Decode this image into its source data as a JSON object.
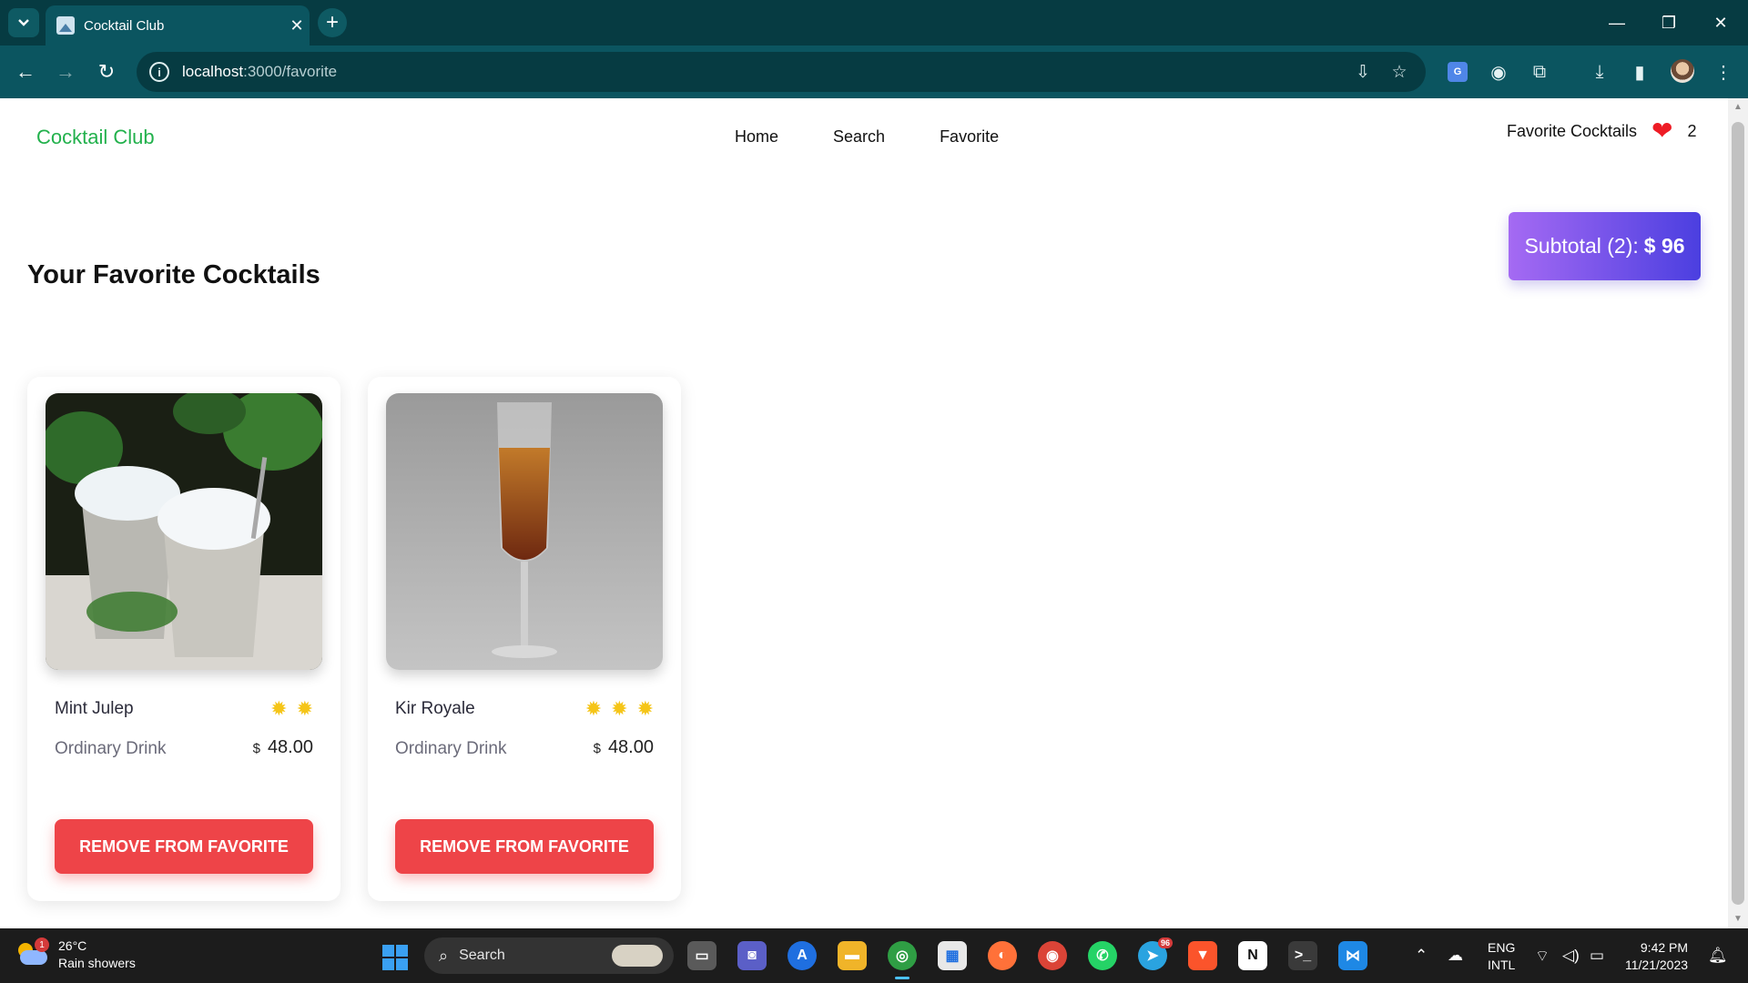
{
  "browser": {
    "tab_title": "Cocktail Club",
    "url_host": "localhost",
    "url_path": ":3000/favorite"
  },
  "page": {
    "brand": "Cocktail Club",
    "nav": [
      "Home",
      "Search",
      "Favorite"
    ],
    "favorites_label": "Favorite Cocktails",
    "favorites_count": "2",
    "subtotal_label": "Subtotal (2):",
    "subtotal_value": "$ 96",
    "heading": "Your Favorite Cocktails",
    "cards": [
      {
        "name": "Mint Julep",
        "rating": 2,
        "category": "Ordinary Drink",
        "currency": "$",
        "price": "48.00",
        "button": "REMOVE FROM FAVORITE"
      },
      {
        "name": "Kir Royale",
        "rating": 3,
        "category": "Ordinary Drink",
        "currency": "$",
        "price": "48.00",
        "button": "REMOVE FROM FAVORITE"
      }
    ]
  },
  "taskbar": {
    "weather_temp": "26°C",
    "weather_desc": "Rain showers",
    "weather_badge": "1",
    "search_label": "Search",
    "telegram_badge": "96",
    "lang_top": "ENG",
    "lang_bottom": "INTL",
    "time": "9:42 PM",
    "date": "11/21/2023"
  },
  "colors": {
    "brand_green": "#22b14c",
    "remove_red": "#ee4448",
    "subtotal_gradient_start": "#a56af3",
    "subtotal_gradient_end": "#4b3fe0",
    "chrome_teal": "#0b5560"
  }
}
